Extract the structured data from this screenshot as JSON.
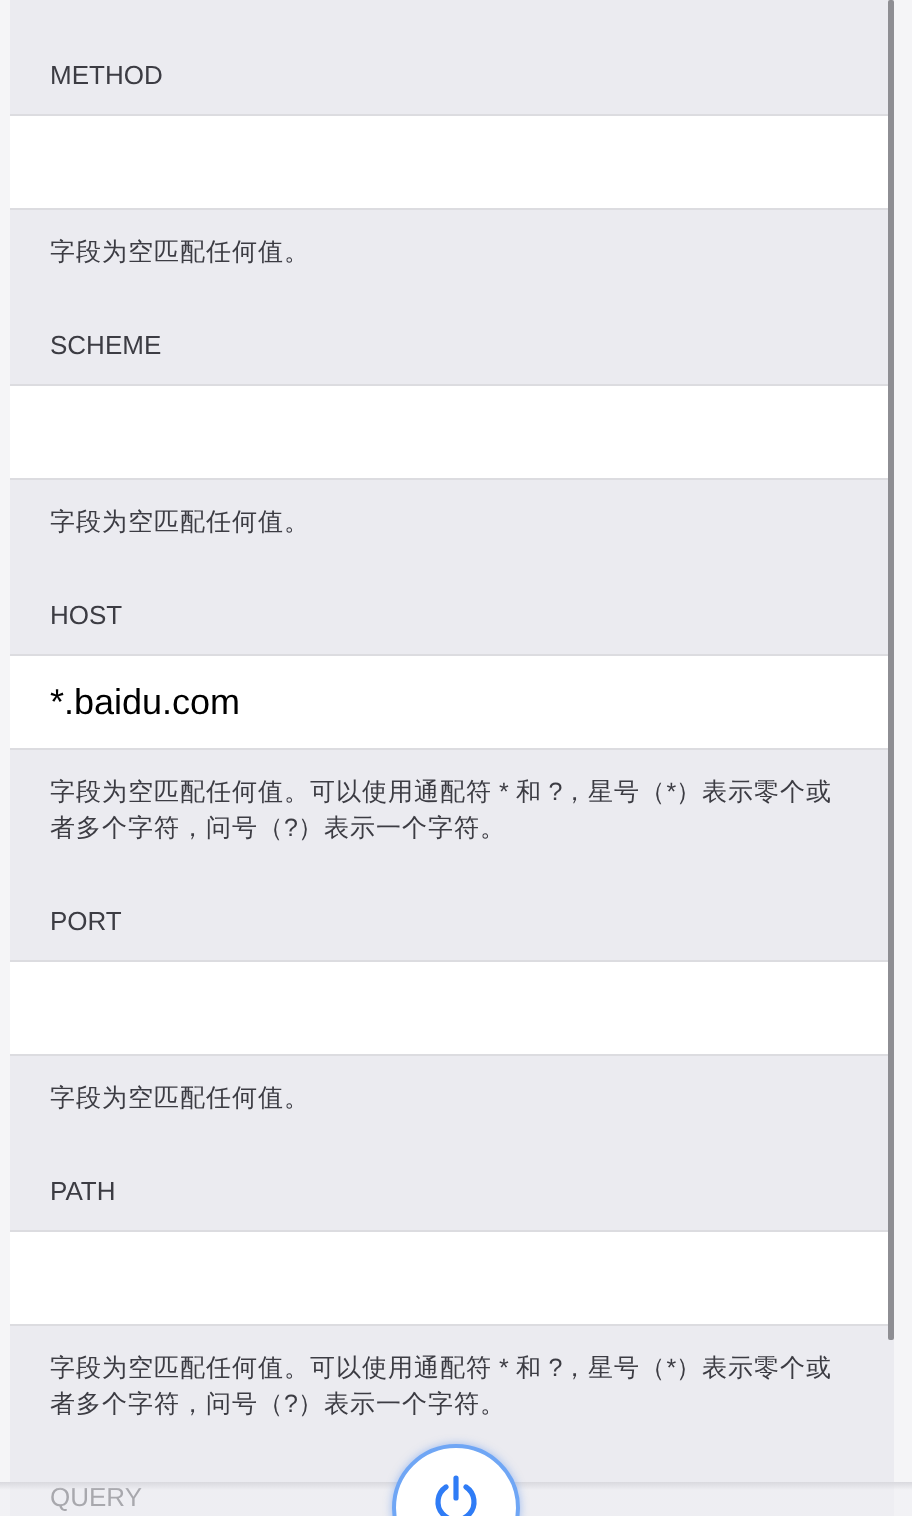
{
  "sections": [
    {
      "label": "METHOD",
      "note": "字段为空匹配任何值。"
    },
    {
      "label": "SCHEME",
      "note": "字段为空匹配任何值。"
    },
    {
      "label": "HOST",
      "value": "*.baidu.com",
      "note": "字段为空匹配任何值。可以使用通配符 * 和 ?，星号（*）表示零个或者多个字符，问号（?）表示一个字符。"
    },
    {
      "label": "PORT",
      "note": "字段为空匹配任何值。"
    },
    {
      "label": "PATH",
      "note": "字段为空匹配任何值。可以使用通配符 * 和 ?，星号（*）表示零个或者多个字符，问号（?）表示一个字符。"
    },
    {
      "label": "QUERY"
    }
  ]
}
